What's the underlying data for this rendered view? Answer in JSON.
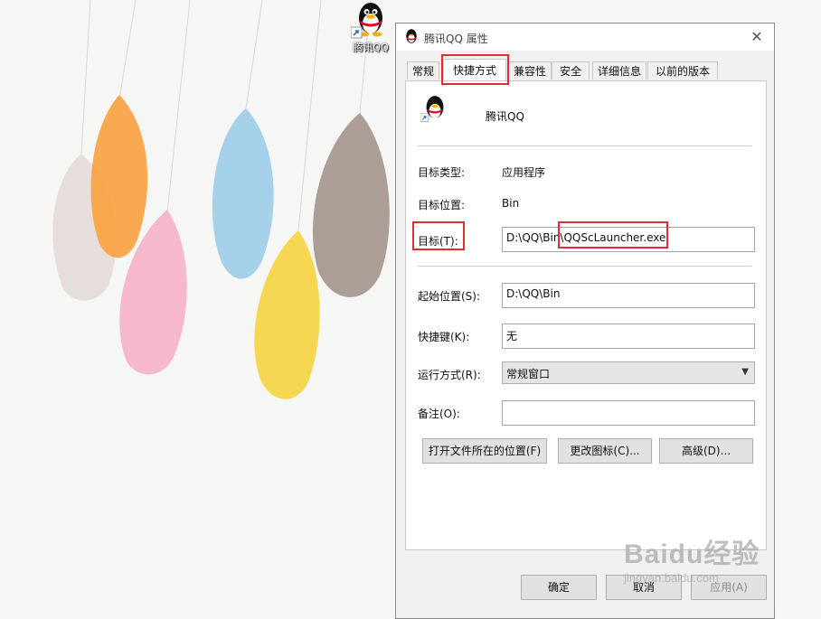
{
  "desktop": {
    "icon_label": "腾讯QQ"
  },
  "dialog": {
    "title": "腾讯QQ 属性",
    "tabs": [
      "常规",
      "快捷方式",
      "兼容性",
      "安全",
      "详细信息",
      "以前的版本"
    ],
    "shortcut_name": "腾讯QQ",
    "target_type_label": "目标类型:",
    "target_type_value": "应用程序",
    "target_location_label": "目标位置:",
    "target_location_value": "Bin",
    "target_label": "目标(T):",
    "target_value_prefix": "D:\\QQ\\Bin\\",
    "target_value_file": "QQScLauncher.exe",
    "start_in_label": "起始位置(S):",
    "start_in_value": "D:\\QQ\\Bin",
    "hotkey_label": "快捷键(K):",
    "hotkey_value": "无",
    "run_label": "运行方式(R):",
    "run_value": "常规窗口",
    "comment_label": "备注(O):",
    "comment_value": "",
    "btn_open_location": "打开文件所在的位置(F)",
    "btn_change_icon": "更改图标(C)...",
    "btn_advanced": "高级(D)...",
    "btn_ok": "确定",
    "btn_cancel": "取消",
    "btn_apply": "应用(A)"
  },
  "watermark": {
    "brand": "Baidu经验",
    "url": "jingyan.baidu.com"
  },
  "colors": {
    "highlight": "#e32b34",
    "dialog_bg": "#f0f0f0"
  }
}
